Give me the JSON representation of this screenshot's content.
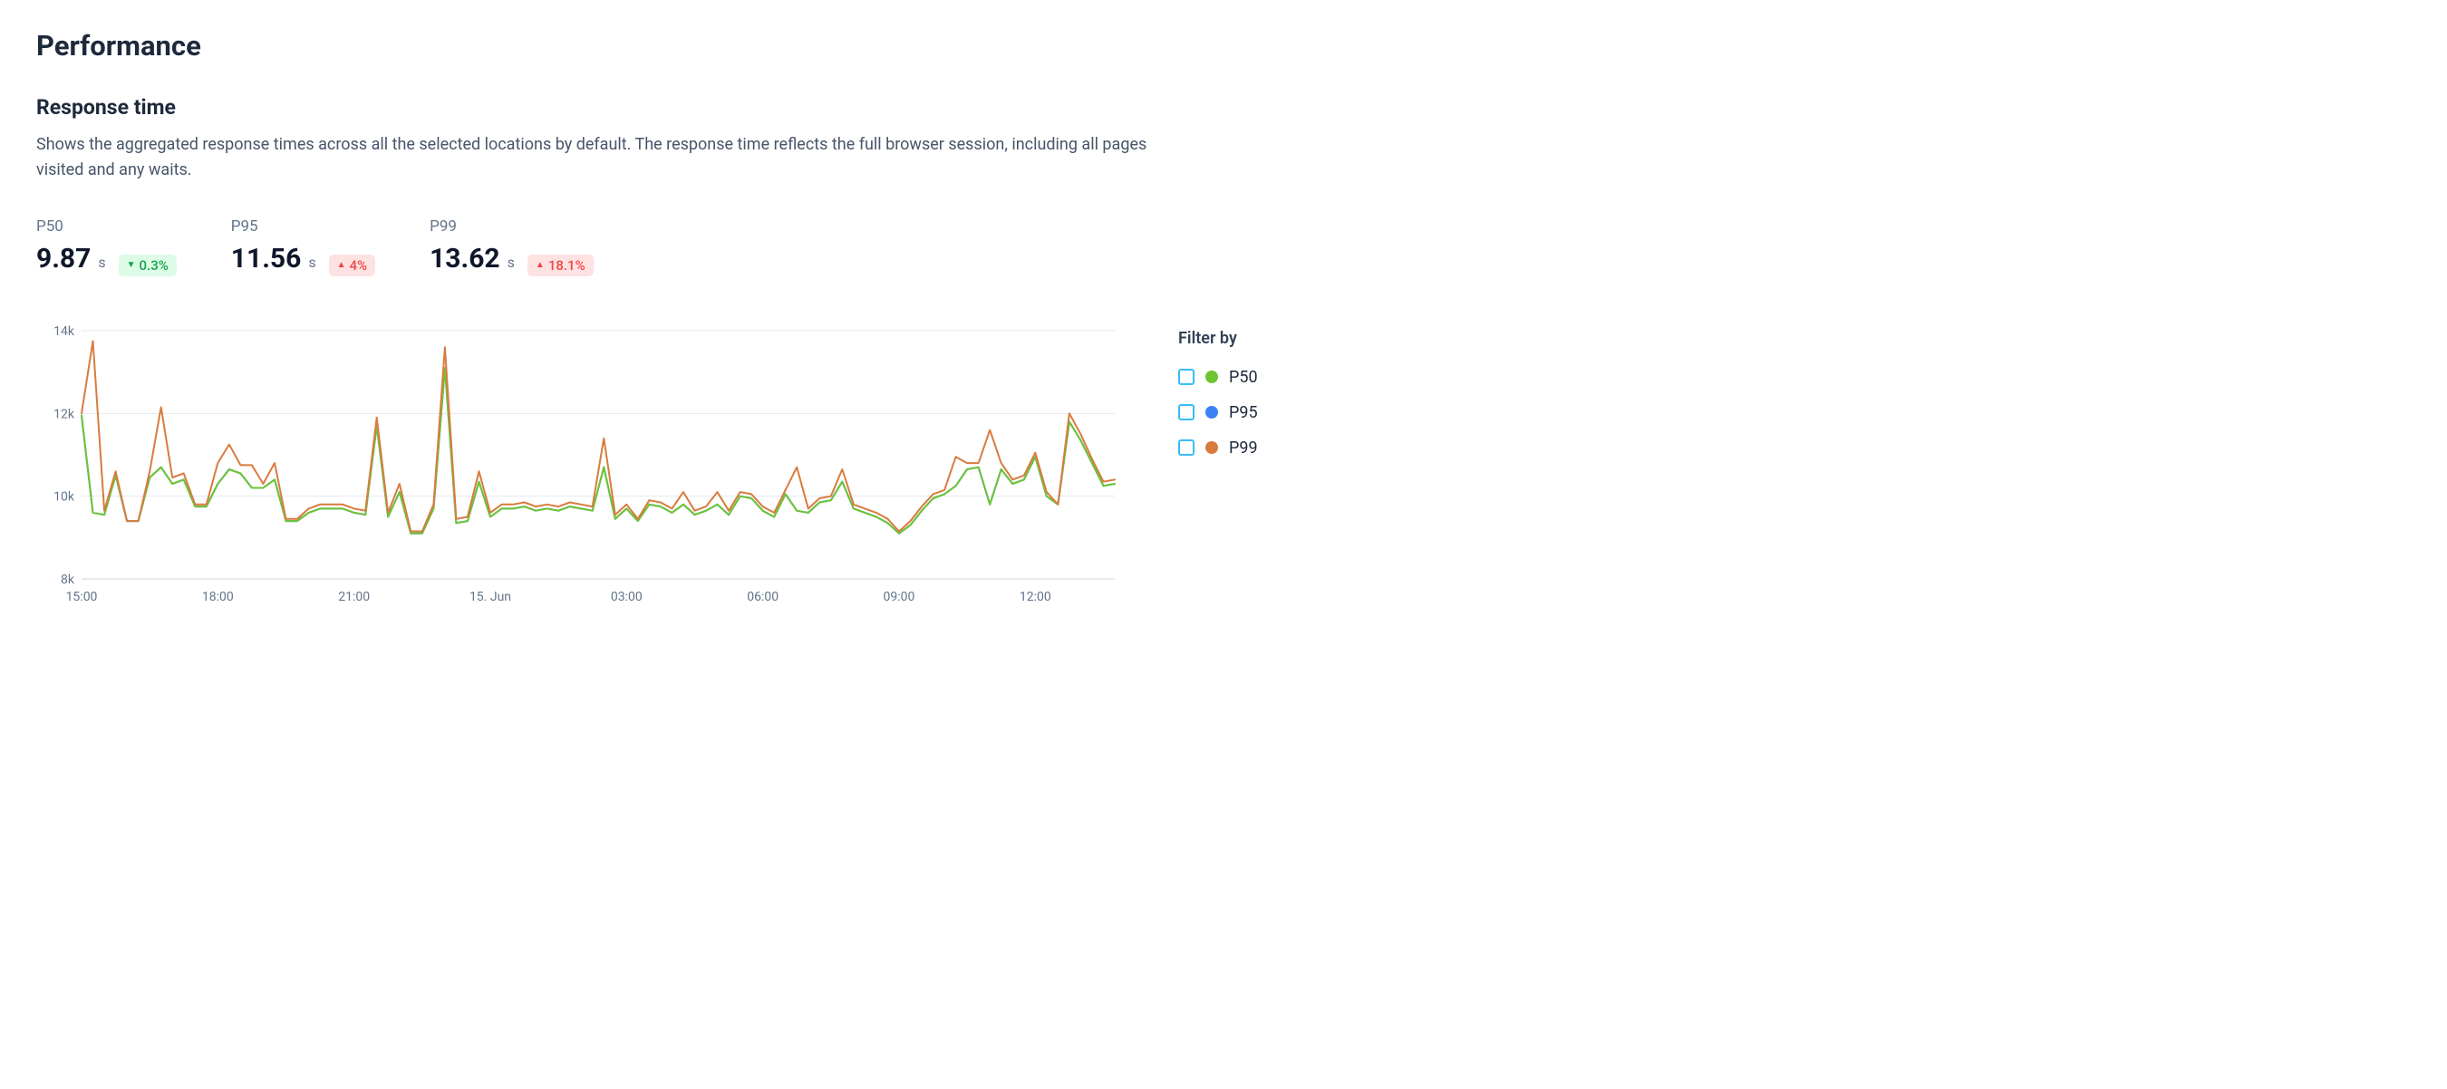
{
  "page": {
    "title": "Performance"
  },
  "section": {
    "title": "Response time",
    "description": "Shows the aggregated response times across all the selected locations by default. The response time reflects the full browser session, including all pages visited and any waits."
  },
  "metrics": [
    {
      "label": "P50",
      "value": "9.87",
      "unit": "s",
      "delta": "0.3%",
      "direction": "down"
    },
    {
      "label": "P95",
      "value": "11.56",
      "unit": "s",
      "delta": "4%",
      "direction": "up"
    },
    {
      "label": "P99",
      "value": "13.62",
      "unit": "s",
      "delta": "18.1%",
      "direction": "up"
    }
  ],
  "legend": {
    "title": "Filter by",
    "items": [
      {
        "label": "P50",
        "color": "#6ec531"
      },
      {
        "label": "P95",
        "color": "#3b82f6"
      },
      {
        "label": "P99",
        "color": "#d97b3f"
      }
    ]
  },
  "chart_data": {
    "type": "line",
    "title": "",
    "xlabel": "",
    "ylabel": "",
    "ylim": [
      8000,
      14000
    ],
    "y_ticks": [
      8000,
      10000,
      12000,
      14000
    ],
    "y_tick_labels": [
      "8k",
      "10k",
      "12k",
      "14k"
    ],
    "x_tick_labels": [
      "15:00",
      "18:00",
      "21:00",
      "15. Jun",
      "03:00",
      "06:00",
      "09:00",
      "12:00"
    ],
    "x_tick_positions": [
      0,
      12,
      24,
      36,
      48,
      60,
      72,
      84
    ],
    "series": [
      {
        "name": "P50",
        "color": "#6ec531",
        "values": [
          11950,
          9600,
          9550,
          10500,
          9400,
          9400,
          10450,
          10700,
          10300,
          10400,
          9750,
          9750,
          10300,
          10650,
          10550,
          10200,
          10200,
          10400,
          9400,
          9400,
          9600,
          9700,
          9700,
          9700,
          9600,
          9550,
          11700,
          9500,
          10100,
          9100,
          9100,
          9700,
          13100,
          9350,
          9400,
          10350,
          9500,
          9700,
          9700,
          9750,
          9650,
          9700,
          9650,
          9750,
          9700,
          9650,
          10700,
          9450,
          9700,
          9400,
          9800,
          9750,
          9600,
          9800,
          9550,
          9650,
          9800,
          9550,
          10000,
          9950,
          9650,
          9500,
          10050,
          9650,
          9600,
          9850,
          9900,
          10350,
          9700,
          9600,
          9500,
          9350,
          9100,
          9300,
          9650,
          9950,
          10050,
          10250,
          10650,
          10700,
          9800,
          10650,
          10300,
          10400,
          10950,
          10000,
          9800,
          11800,
          11350,
          10800,
          10250,
          10300
        ]
      },
      {
        "name": "P95",
        "color": "#3b82f6",
        "values": [
          11950,
          9600,
          9550,
          10500,
          9400,
          9400,
          10450,
          10700,
          10300,
          10400,
          9750,
          9750,
          10300,
          10650,
          10550,
          10200,
          10200,
          10400,
          9400,
          9400,
          9600,
          9700,
          9700,
          9700,
          9600,
          9550,
          11700,
          9500,
          10100,
          9100,
          9100,
          9700,
          13100,
          9350,
          9400,
          10350,
          9500,
          9700,
          9700,
          9750,
          9650,
          9700,
          9650,
          9750,
          9700,
          9650,
          10700,
          9450,
          9700,
          9400,
          9800,
          9750,
          9600,
          9800,
          9550,
          9650,
          9800,
          9550,
          10000,
          9950,
          9650,
          9500,
          10050,
          9650,
          9600,
          9850,
          9900,
          10350,
          9700,
          9600,
          9500,
          9350,
          9100,
          9300,
          9650,
          9950,
          10050,
          10250,
          10650,
          10700,
          9800,
          10650,
          10300,
          10400,
          10950,
          10000,
          9800,
          11800,
          11350,
          10800,
          10250,
          10300
        ]
      },
      {
        "name": "P99",
        "color": "#d97b3f",
        "values": [
          12000,
          13750,
          9650,
          10600,
          9400,
          9400,
          10600,
          12150,
          10450,
          10550,
          9800,
          9800,
          10800,
          11250,
          10750,
          10750,
          10300,
          10800,
          9450,
          9450,
          9700,
          9800,
          9800,
          9800,
          9700,
          9650,
          11900,
          9600,
          10300,
          9150,
          9150,
          9800,
          13600,
          9450,
          9500,
          10600,
          9600,
          9800,
          9800,
          9850,
          9750,
          9800,
          9750,
          9850,
          9800,
          9750,
          11400,
          9550,
          9800,
          9450,
          9900,
          9850,
          9700,
          10100,
          9650,
          9750,
          10100,
          9650,
          10100,
          10050,
          9750,
          9600,
          10150,
          10700,
          9700,
          9950,
          10000,
          10650,
          9800,
          9700,
          9600,
          9450,
          9150,
          9400,
          9750,
          10050,
          10150,
          10950,
          10800,
          10800,
          11600,
          10800,
          10400,
          10500,
          11050,
          10100,
          9800,
          12000,
          11500,
          10900,
          10350,
          10400
        ]
      }
    ]
  }
}
